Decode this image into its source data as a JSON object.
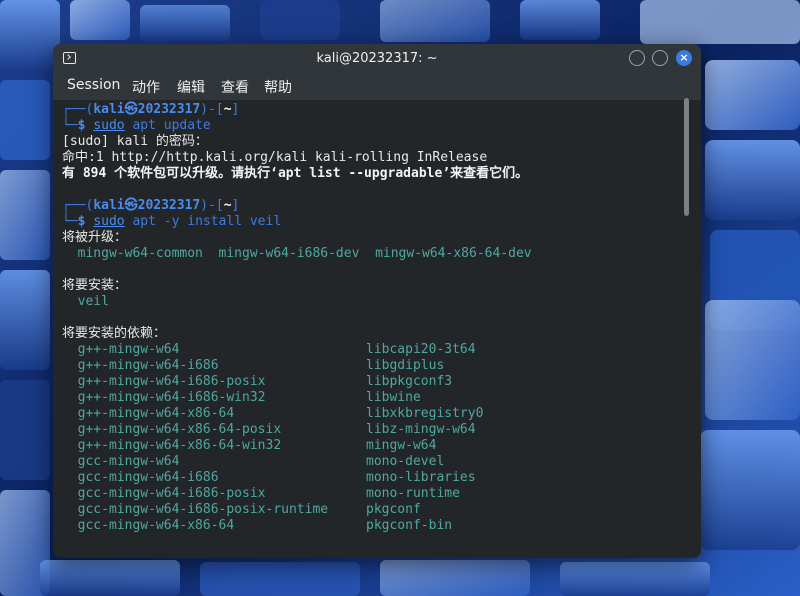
{
  "window": {
    "title": "kali@20232317: ~"
  },
  "menu": [
    "Session",
    "动作",
    "编辑",
    "查看",
    "帮助"
  ],
  "prompt1": {
    "open": "┌──(",
    "user": "kali㉿20232317",
    "dir_open": ")-[",
    "dir": "~",
    "dir_close": "]",
    "end": "└─",
    "dollar": "$",
    "sudo": "sudo",
    "cmd": " apt update"
  },
  "output1": [
    "[sudo] kali 的密码：",
    "命中:1 http://http.kali.org/kali kali-rolling InRelease",
    "有 894 个软件包可以升级。请执行‘apt list --upgradable’来查看它们。"
  ],
  "prompt2": {
    "open": "┌──(",
    "user": "kali㉿20232317",
    "dir_open": ")-[",
    "dir": "~",
    "dir_close": "]",
    "end": "└─",
    "dollar": "$",
    "sudo": "sudo",
    "cmd": " apt -y install veil"
  },
  "upgrade_header": "将被升级：",
  "upgrade_list": "  mingw-w64-common  mingw-w64-i686-dev  mingw-w64-x86-64-dev",
  "install_header": "将要安装：",
  "install_list": "  veil",
  "deps_header": "将要安装的依赖：",
  "deps_left": [
    "  g++-mingw-w64",
    "  g++-mingw-w64-i686",
    "  g++-mingw-w64-i686-posix",
    "  g++-mingw-w64-i686-win32",
    "  g++-mingw-w64-x86-64",
    "  g++-mingw-w64-x86-64-posix",
    "  g++-mingw-w64-x86-64-win32",
    "  gcc-mingw-w64",
    "  gcc-mingw-w64-i686",
    "  gcc-mingw-w64-i686-posix",
    "  gcc-mingw-w64-i686-posix-runtime",
    "  gcc-mingw-w64-x86-64"
  ],
  "deps_right": [
    "libcapi20-3t64",
    "libgdiplus",
    "libpkgconf3",
    "libwine",
    "libxkbregistry0",
    "libz-mingw-w64",
    "mingw-w64",
    "mono-devel",
    "mono-libraries",
    "mono-runtime",
    "pkgconf",
    "pkgconf-bin"
  ]
}
